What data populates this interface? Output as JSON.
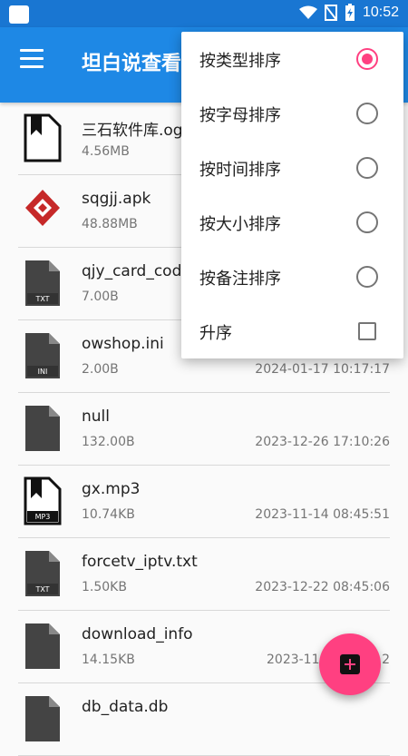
{
  "status_bar": {
    "time": "10:52"
  },
  "app_bar": {
    "title": "坦白说查看",
    "menu_icon": "hamburger-menu-icon"
  },
  "files": [
    {
      "name": "三石软件库.og",
      "size": "4.56MB",
      "date": "",
      "icon": "file-bookmark-icon",
      "tag": ""
    },
    {
      "name": "sqgjj.apk",
      "size": "48.88MB",
      "date": "",
      "icon": "app-logo-icon",
      "tag": ""
    },
    {
      "name": "qjy_card_code",
      "size": "7.00B",
      "date": "",
      "icon": "file-icon",
      "tag": "TXT"
    },
    {
      "name": "owshop.ini",
      "size": "2.00B",
      "date": "2024-01-17 10:17:17",
      "icon": "file-icon",
      "tag": "INI"
    },
    {
      "name": "null",
      "size": "132.00B",
      "date": "2023-12-26 17:10:26",
      "icon": "file-icon",
      "tag": ""
    },
    {
      "name": "gx.mp3",
      "size": "10.74KB",
      "date": "2023-11-14 08:45:51",
      "icon": "file-bookmark-icon",
      "tag": "MP3"
    },
    {
      "name": "forcetv_iptv.txt",
      "size": "1.50KB",
      "date": "2023-12-22 08:45:06",
      "icon": "file-icon",
      "tag": "TXT"
    },
    {
      "name": "download_info",
      "size": "14.15KB",
      "date": "2023-11-",
      "date_tail": "2",
      "icon": "file-icon",
      "tag": ""
    },
    {
      "name": "db_data.db",
      "size": "",
      "date": "",
      "icon": "file-icon",
      "tag": ""
    }
  ],
  "sort_menu": {
    "items": [
      {
        "label": "按类型排序",
        "checked": true
      },
      {
        "label": "按字母排序",
        "checked": false
      },
      {
        "label": "按时间排序",
        "checked": false
      },
      {
        "label": "按大小排序",
        "checked": false
      },
      {
        "label": "按备注排序",
        "checked": false
      }
    ],
    "ascending": {
      "label": "升序",
      "checked": false
    }
  },
  "fab": {
    "icon": "add-box-icon"
  },
  "colors": {
    "primary": "#1e88e5",
    "status": "#1976d2",
    "accent": "#ff4081"
  }
}
